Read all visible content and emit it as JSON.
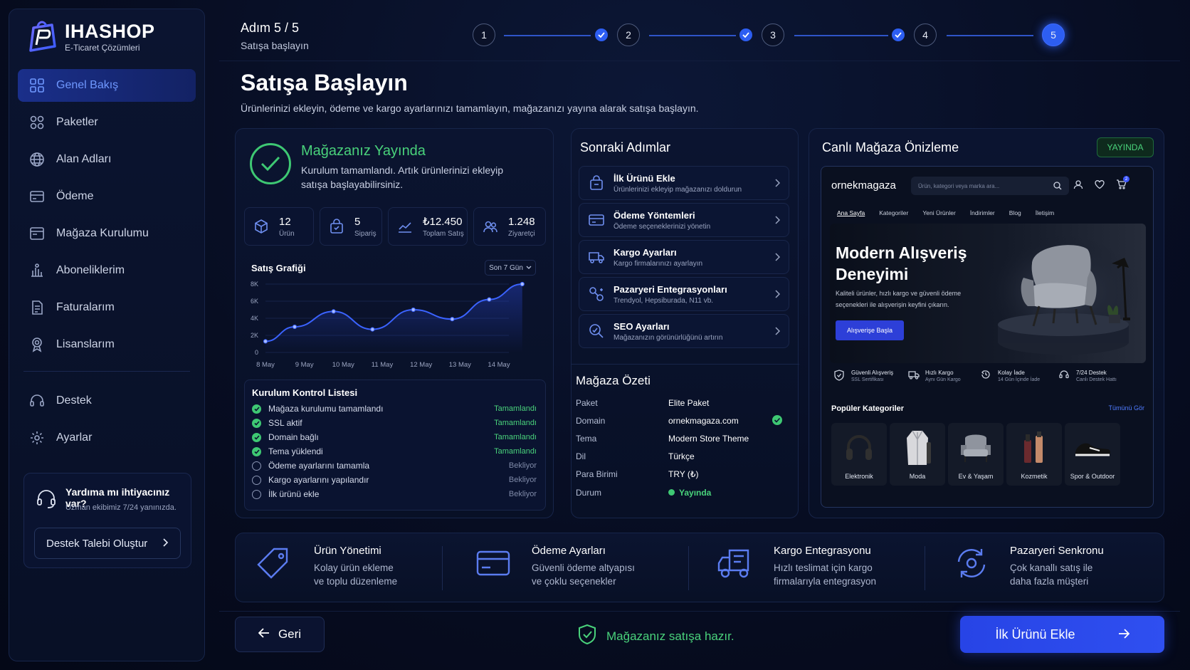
{
  "brand": {
    "name": "IHASHOP",
    "tagline": "E-Ticaret Çözümleri"
  },
  "sidebar": {
    "items": [
      {
        "label": "Genel Bakış",
        "icon": "grid-icon",
        "active": true
      },
      {
        "label": "Paketler",
        "icon": "packages-icon"
      },
      {
        "label": "Alan Adları",
        "icon": "globe-icon"
      },
      {
        "label": "Ödeme",
        "icon": "credit-card-icon"
      },
      {
        "label": "Mağaza Kurulumu",
        "icon": "store-icon"
      },
      {
        "label": "Aboneliklerim",
        "icon": "subscriptions-icon"
      },
      {
        "label": "Faturalarım",
        "icon": "invoice-icon"
      },
      {
        "label": "Lisanslarım",
        "icon": "license-icon"
      }
    ],
    "bottom_items": [
      {
        "label": "Destek",
        "icon": "headset-icon"
      },
      {
        "label": "Ayarlar",
        "icon": "gear-icon"
      }
    ],
    "help": {
      "title": "Yardıma mı ihtiyacınız var?",
      "subtitle": "Uzman ekibimiz 7/24 yanınızda.",
      "button": "Destek Talebi Oluştur"
    }
  },
  "header": {
    "step_label": "Adım 5 / 5",
    "step_sub": "Satışa başlayın",
    "steps": [
      "1",
      "2",
      "3",
      "4",
      "5"
    ],
    "current_step": 5
  },
  "page": {
    "title": "Satışa Başlayın",
    "description": "Ürünlerinizi ekleyin, ödeme ve kargo ayarlarınızı tamamlayın, mağazanızı yayına alarak satışa başlayın."
  },
  "live": {
    "title": "Mağazanız Yayında",
    "description": "Kurulum tamamlandı. Artık ürünlerinizi ekleyip satışa başlayabilirsiniz.",
    "stats": [
      {
        "value": "12",
        "label": "Ürün",
        "icon": "cube-icon"
      },
      {
        "value": "5",
        "label": "Sipariş",
        "icon": "shopping-bag-icon"
      },
      {
        "value": "₺12.450",
        "label": "Toplam Satış",
        "icon": "trend-chart-icon"
      },
      {
        "value": "1.248",
        "label": "Ziyaretçi",
        "icon": "users-icon"
      }
    ],
    "chart_title": "Satış Grafiği",
    "range": "Son 7 Gün",
    "checklist_title": "Kurulum Kontrol Listesi",
    "checklist": [
      {
        "label": "Mağaza kurulumu tamamlandı",
        "status": "Tamamlandı",
        "done": true
      },
      {
        "label": "SSL aktif",
        "status": "Tamamlandı",
        "done": true
      },
      {
        "label": "Domain bağlı",
        "status": "Tamamlandı",
        "done": true
      },
      {
        "label": "Tema yüklendi",
        "status": "Tamamlandı",
        "done": true
      },
      {
        "label": "Ödeme ayarlarını tamamla",
        "status": "Bekliyor",
        "done": false
      },
      {
        "label": "Kargo ayarlarını yapılandır",
        "status": "Bekliyor",
        "done": false
      },
      {
        "label": "İlk ürünü ekle",
        "status": "Bekliyor",
        "done": false
      }
    ]
  },
  "chart_data": {
    "type": "line",
    "title": "Satış Grafiği",
    "xlabel": "",
    "ylabel": "",
    "x_ticks": [
      "8 May",
      "9 May",
      "10 May",
      "11 May",
      "12 May",
      "13 May",
      "14 May"
    ],
    "y_ticks": [
      "0",
      "2K",
      "4K",
      "6K",
      "8K"
    ],
    "ylim": [
      0,
      8000
    ],
    "series": [
      {
        "values": [
          1300,
          3000,
          4800,
          2700,
          5000,
          3900,
          6200,
          8000
        ],
        "x": [
          0,
          0.75,
          1.75,
          2.75,
          3.8,
          4.8,
          5.75,
          6.6
        ]
      }
    ],
    "grid": true,
    "color": "#3b63ff"
  },
  "next_steps": {
    "title": "Sonraki Adımlar",
    "items": [
      {
        "title": "İlk Ürünü Ekle",
        "subtitle": "Ürünlerinizi ekleyip mağazanızı doldurun",
        "icon": "shopping-bag-icon"
      },
      {
        "title": "Ödeme Yöntemleri",
        "subtitle": "Ödeme seçeneklerinizi yönetin",
        "icon": "credit-card-icon"
      },
      {
        "title": "Kargo Ayarları",
        "subtitle": "Kargo firmalarınızı ayarlayın",
        "icon": "truck-icon"
      },
      {
        "title": "Pazaryeri Entegrasyonları",
        "subtitle": "Trendyol, Hepsiburada, N11 vb.",
        "icon": "integration-icon"
      },
      {
        "title": "SEO Ayarları",
        "subtitle": "Mağazanızın görünürlüğünü artırın",
        "icon": "seo-search-icon"
      }
    ]
  },
  "summary": {
    "title": "Mağaza Özeti",
    "rows": [
      {
        "key": "Paket",
        "value": "Elite Paket"
      },
      {
        "key": "Domain",
        "value": "ornekmagaza.com"
      },
      {
        "key": "Tema",
        "value": "Modern Store Theme"
      },
      {
        "key": "Dil",
        "value": "Türkçe"
      },
      {
        "key": "Para Birimi",
        "value": "TRY (₺)"
      },
      {
        "key": "Durum",
        "value": "Yayında"
      }
    ]
  },
  "preview": {
    "title": "Canlı Mağaza Önizleme",
    "badge": "YAYINDA",
    "store_name": "ornekmagaza",
    "search_placeholder": "Ürün, kategori veya marka ara...",
    "nav": [
      "Ana Sayfa",
      "Kategoriler",
      "Yeni Ürünler",
      "İndirimler",
      "Blog",
      "İletişim"
    ],
    "hero_title": "Modern Alışveriş Deneyimi",
    "hero_sub": "Kaliteli ürünler, hızlı kargo ve güvenli ödeme seçenekleri ile alışverişin keyfini çıkarın.",
    "hero_button": "Alışverişe Başla",
    "features": [
      {
        "title": "Güvenli Alışveriş",
        "sub": "SSL Sertifikası",
        "icon": "shield-icon"
      },
      {
        "title": "Hızlı Kargo",
        "sub": "Aynı Gün Kargo",
        "icon": "truck-icon"
      },
      {
        "title": "Kolay İade",
        "sub": "14 Gün İçinde İade",
        "icon": "return-icon"
      },
      {
        "title": "7/24 Destek",
        "sub": "Canlı Destek Hattı",
        "icon": "support-icon"
      }
    ],
    "categories_title": "Popüler Kategoriler",
    "see_all": "Tümünü Gör",
    "categories": [
      "Elektronik",
      "Moda",
      "Ev & Yaşam",
      "Kozmetik",
      "Spor & Outdoor"
    ],
    "cart_count": "2"
  },
  "features": [
    {
      "title": "Ürün Yönetimi",
      "line1": "Kolay ürün ekleme",
      "line2": "ve toplu düzenleme",
      "icon": "tag-icon"
    },
    {
      "title": "Ödeme Ayarları",
      "line1": "Güvenli ödeme altyapısı",
      "line2": "ve çoklu seçenekler",
      "icon": "credit-card-icon"
    },
    {
      "title": "Kargo Entegrasyonu",
      "line1": "Hızlı teslimat için kargo",
      "line2": "firmalarıyla entegrasyon",
      "icon": "truck-icon"
    },
    {
      "title": "Pazaryeri Senkronu",
      "line1": "Çok kanallı satış ile",
      "line2": "daha fazla müşteri",
      "icon": "sync-icon"
    }
  ],
  "footer": {
    "back": "Geri",
    "ready": "Mağazanız satışa hazır.",
    "primary": "İlk Ürünü Ekle"
  }
}
